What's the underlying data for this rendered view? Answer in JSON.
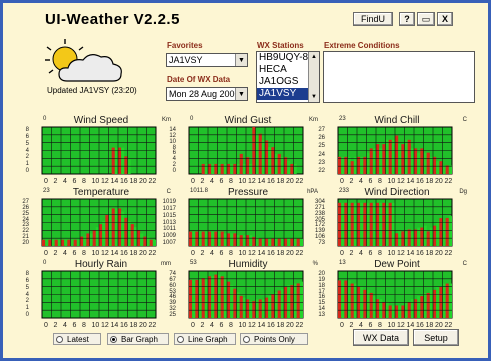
{
  "window": {
    "title": "UI-Weather V2.2.5"
  },
  "title_buttons": {
    "findu": "FindU",
    "help": "?",
    "minimize": "▭",
    "close": "X"
  },
  "favorites": {
    "label": "Favorites",
    "value": "JA1VSY"
  },
  "date": {
    "label": "Date Of WX Data",
    "value": "Mon 28 Aug 2006"
  },
  "stations": {
    "label": "WX Stations",
    "items": [
      "HB9UQY-8",
      "HECA",
      "JA1OGS",
      "JA1VSY"
    ],
    "selected_index": 3
  },
  "extreme": {
    "label": "Extreme Conditions",
    "value": ""
  },
  "status": {
    "updated": "Updated JA1VSY (23:20)"
  },
  "colors": {
    "bar_red": "#d42a1a",
    "bar_green": "#22d42a",
    "grid": "#111111",
    "panel_bg": "#21c02a"
  },
  "panels": [
    {
      "title": "Wind Speed",
      "left_label": "0",
      "unit": "Km",
      "yticks": [
        "8",
        "6",
        "5",
        "4",
        "2",
        "1",
        "0"
      ],
      "xticks": [
        "0",
        "2",
        "4",
        "6",
        "8",
        "10",
        "12",
        "14",
        "16",
        "18",
        "20",
        "22"
      ],
      "values": [
        [
          0,
          0
        ],
        [
          0,
          0
        ],
        [
          0,
          0
        ],
        [
          0,
          0
        ],
        [
          0,
          0
        ],
        [
          0,
          0
        ],
        [
          0,
          0
        ],
        [
          0,
          0
        ],
        [
          0,
          0
        ],
        [
          0,
          0
        ],
        [
          0,
          0
        ],
        [
          0,
          0
        ],
        [
          0,
          0
        ],
        [
          0,
          0
        ],
        [
          0,
          0
        ],
        [
          0,
          0
        ],
        [
          0,
          0
        ],
        [
          0,
          0
        ],
        [
          0,
          0
        ],
        [
          0,
          0
        ],
        [
          0,
          0
        ],
        [
          0,
          0
        ],
        [
          0,
          0
        ],
        [
          0,
          0
        ],
        [
          0,
          0
        ],
        [
          0,
          0
        ],
        [
          0,
          0
        ],
        [
          0,
          0
        ],
        [
          0,
          0
        ],
        [
          0,
          0
        ],
        [
          0,
          0
        ],
        [
          0,
          0
        ],
        [
          0,
          0
        ],
        [
          0,
          0
        ],
        [
          0,
          0
        ],
        [
          0,
          0
        ],
        [
          0,
          0
        ],
        [
          0,
          0
        ],
        [
          0,
          0
        ],
        [
          0,
          0
        ],
        [
          0,
          0
        ],
        [
          0,
          0
        ],
        [
          0,
          0
        ],
        [
          0,
          0
        ],
        [
          0,
          0
        ],
        [
          0,
          0
        ],
        [
          4,
          4
        ],
        [
          4,
          4
        ],
        [
          4,
          4
        ],
        [
          4,
          4
        ],
        [
          4,
          4
        ],
        [
          4,
          4
        ],
        [
          0,
          0
        ],
        [
          0,
          0
        ],
        [
          0,
          0
        ],
        [
          0,
          0
        ],
        [
          0,
          0
        ],
        [
          0,
          0
        ],
        [
          0,
          0
        ],
        [
          0,
          0
        ],
        [
          0,
          0
        ],
        [
          0,
          0
        ],
        [
          0,
          0
        ],
        [
          0,
          0
        ],
        [
          0,
          0
        ],
        [
          0,
          0
        ],
        [
          0,
          0
        ],
        [
          0,
          0
        ],
        [
          0,
          0
        ],
        [
          0,
          0
        ],
        [
          0,
          0
        ],
        [
          0,
          0
        ],
        [
          0,
          0
        ],
        [
          0,
          0
        ],
        [
          0,
          0
        ],
        [
          0,
          0
        ],
        [
          0,
          0
        ],
        [
          0,
          0
        ],
        [
          0,
          0
        ],
        [
          0,
          0
        ],
        [
          0,
          0
        ],
        [
          0,
          0
        ],
        [
          0,
          0
        ],
        [
          0,
          0
        ],
        [
          0,
          0
        ],
        [
          0,
          0
        ],
        [
          0,
          0
        ],
        [
          0,
          0
        ],
        [
          0,
          0
        ],
        [
          0,
          0
        ],
        [
          0,
          0
        ],
        [
          0,
          0
        ],
        [
          0,
          0
        ],
        [
          0,
          0
        ],
        [
          0,
          0
        ],
        [
          0,
          0
        ]
      ],
      "series": [
        0,
        0,
        0,
        0,
        0,
        0,
        0,
        0,
        0,
        0,
        0,
        0,
        0,
        0,
        0,
        0,
        0,
        0,
        0,
        0,
        0,
        0,
        4.5,
        4.5,
        4.5,
        4.5,
        3,
        2.5,
        0,
        0,
        0,
        0,
        0,
        0,
        0,
        0
      ],
      "ymax": 8
    },
    {
      "title": "Wind Gust",
      "left_label": "0",
      "unit": "Km",
      "yticks": [
        "14",
        "12",
        "10",
        "8",
        "6",
        "4",
        "2",
        "0"
      ],
      "xticks": [
        "0",
        "2",
        "4",
        "6",
        "8",
        "10",
        "12",
        "14",
        "16",
        "18",
        "20",
        "22"
      ],
      "series": [
        0,
        0,
        0,
        0,
        3,
        3,
        3,
        3,
        3,
        3,
        3,
        3,
        3,
        3,
        3,
        3,
        6,
        3,
        5,
        3,
        14,
        12,
        12,
        10,
        10,
        8,
        8,
        6,
        6,
        5,
        5,
        4,
        3,
        3,
        0,
        0
      ],
      "ymax": 14
    },
    {
      "title": "Wind Chill",
      "left_label": "23",
      "unit": "C",
      "yticks": [
        "27",
        "26",
        "25",
        "24",
        "23",
        "22"
      ],
      "xticks": [
        "0",
        "2",
        "4",
        "6",
        "8",
        "10",
        "12",
        "14",
        "16",
        "18",
        "20",
        "22"
      ],
      "series": [
        24,
        24,
        24,
        24,
        23.5,
        24,
        24,
        24,
        24,
        24.5,
        25,
        25,
        25.5,
        25,
        25.5,
        26,
        26,
        26,
        26.5,
        25.5,
        25.5,
        26,
        26,
        25,
        25,
        24.5,
        25,
        24.5,
        24.5,
        24,
        24,
        23.5,
        23.5,
        23,
        23,
        23
      ],
      "ymin": 22,
      "ymax": 27.5
    },
    {
      "title": "Temperature",
      "left_label": "23",
      "unit": "C",
      "yticks": [
        "27",
        "26",
        "25",
        "24",
        "23",
        "22",
        "21",
        "20"
      ],
      "xticks": [
        "0",
        "2",
        "4",
        "6",
        "8",
        "10",
        "12",
        "14",
        "16",
        "18",
        "20",
        "22"
      ],
      "series": [
        21,
        21,
        21,
        21,
        21,
        21,
        21,
        21,
        21,
        21,
        21,
        21,
        21.5,
        21.5,
        22,
        22,
        22.5,
        23,
        23.5,
        24,
        25,
        26,
        26,
        26,
        26,
        25.5,
        24.5,
        24,
        23.5,
        23,
        22.5,
        22,
        21.5,
        21.5,
        21,
        21
      ],
      "ymin": 20,
      "ymax": 27.5
    },
    {
      "title": "Pressure",
      "left_label": "1011.8",
      "unit": "hPA",
      "yticks": [
        "1019",
        "1017",
        "1015",
        "1013",
        "1011",
        "1009",
        "1007"
      ],
      "xticks": [
        "0",
        "2",
        "4",
        "6",
        "8",
        "10",
        "12",
        "14",
        "16",
        "18",
        "20",
        "22"
      ],
      "series": [
        1011,
        1011,
        1011,
        1011,
        1011,
        1011,
        1011,
        1011,
        1011,
        1011,
        1011,
        1010.5,
        1010.5,
        1010.5,
        1010.5,
        1010,
        1010,
        1010,
        1010,
        1010,
        1009.5,
        1009.5,
        1009,
        1009,
        1009,
        1009,
        1009,
        1009,
        1009,
        1009,
        1009,
        1009,
        1009,
        1009,
        1009,
        1009
      ],
      "ymin": 1007,
      "ymax": 1020
    },
    {
      "title": "Wind Direction",
      "left_label": "233",
      "unit": "Dg",
      "yticks": [
        "304",
        "271",
        "238",
        "205",
        "172",
        "139",
        "106",
        "73"
      ],
      "xticks": [
        "0",
        "2",
        "4",
        "6",
        "8",
        "10",
        "12",
        "14",
        "16",
        "18",
        "20",
        "22"
      ],
      "series": [
        300,
        300,
        300,
        300,
        300,
        300,
        300,
        300,
        300,
        300,
        300,
        300,
        300,
        300,
        300,
        300,
        300,
        300,
        140,
        150,
        150,
        150,
        160,
        150,
        160,
        170,
        170,
        180,
        150,
        170,
        180,
        200,
        220,
        200,
        220,
        230
      ],
      "ymin": 73,
      "ymax": 320
    },
    {
      "title": "Hourly Rain",
      "left_label": "0",
      "unit": "mm",
      "yticks": [
        "8",
        "6",
        "5",
        "4",
        "2",
        "1",
        "0"
      ],
      "xticks": [
        "0",
        "2",
        "4",
        "6",
        "8",
        "10",
        "12",
        "14",
        "16",
        "18",
        "20",
        "22"
      ],
      "series": [
        0,
        0,
        0,
        0,
        0,
        0,
        0,
        0,
        0,
        0,
        0,
        0,
        0,
        0,
        0,
        0,
        0,
        0,
        0,
        0,
        0,
        0,
        0,
        0,
        0,
        0,
        0,
        0,
        0,
        0,
        0,
        0,
        0,
        0,
        0,
        0
      ],
      "ymax": 8
    },
    {
      "title": "Humidity",
      "left_label": "53",
      "unit": "%",
      "yticks": [
        "74",
        "67",
        "60",
        "53",
        "46",
        "39",
        "32",
        "25"
      ],
      "xticks": [
        "0",
        "2",
        "4",
        "6",
        "8",
        "10",
        "12",
        "14",
        "16",
        "18",
        "20",
        "22"
      ],
      "series": [
        68,
        68,
        68,
        69,
        70,
        70,
        72,
        72,
        74,
        74,
        72,
        70,
        66,
        62,
        58,
        54,
        50,
        48,
        46,
        44,
        44,
        46,
        46,
        46,
        48,
        50,
        52,
        54,
        56,
        58,
        60,
        62,
        62,
        64,
        64,
        66
      ],
      "ymin": 25,
      "ymax": 78
    },
    {
      "title": "Dew Point",
      "left_label": "13",
      "unit": "C",
      "yticks": [
        "20",
        "19",
        "18",
        "17",
        "16",
        "15",
        "14",
        "13"
      ],
      "xticks": [
        "0",
        "2",
        "4",
        "6",
        "8",
        "10",
        "12",
        "14",
        "16",
        "18",
        "20",
        "22"
      ],
      "series": [
        19,
        19,
        19,
        19,
        18.5,
        18.5,
        18,
        18,
        17.5,
        17.5,
        17,
        16.5,
        16,
        16,
        15.5,
        15.5,
        15,
        15,
        15,
        15,
        15,
        15.5,
        15.5,
        16,
        16,
        16.5,
        16.5,
        17,
        17,
        17.5,
        17.5,
        18,
        18,
        18.5,
        18.5,
        18.5
      ],
      "ymin": 13,
      "ymax": 20.5
    }
  ],
  "bottom": {
    "radios": [
      "Latest",
      "Bar Graph",
      "Line Graph",
      "Points Only"
    ],
    "selected": 1,
    "wx_data": "WX Data",
    "setup": "Setup"
  }
}
